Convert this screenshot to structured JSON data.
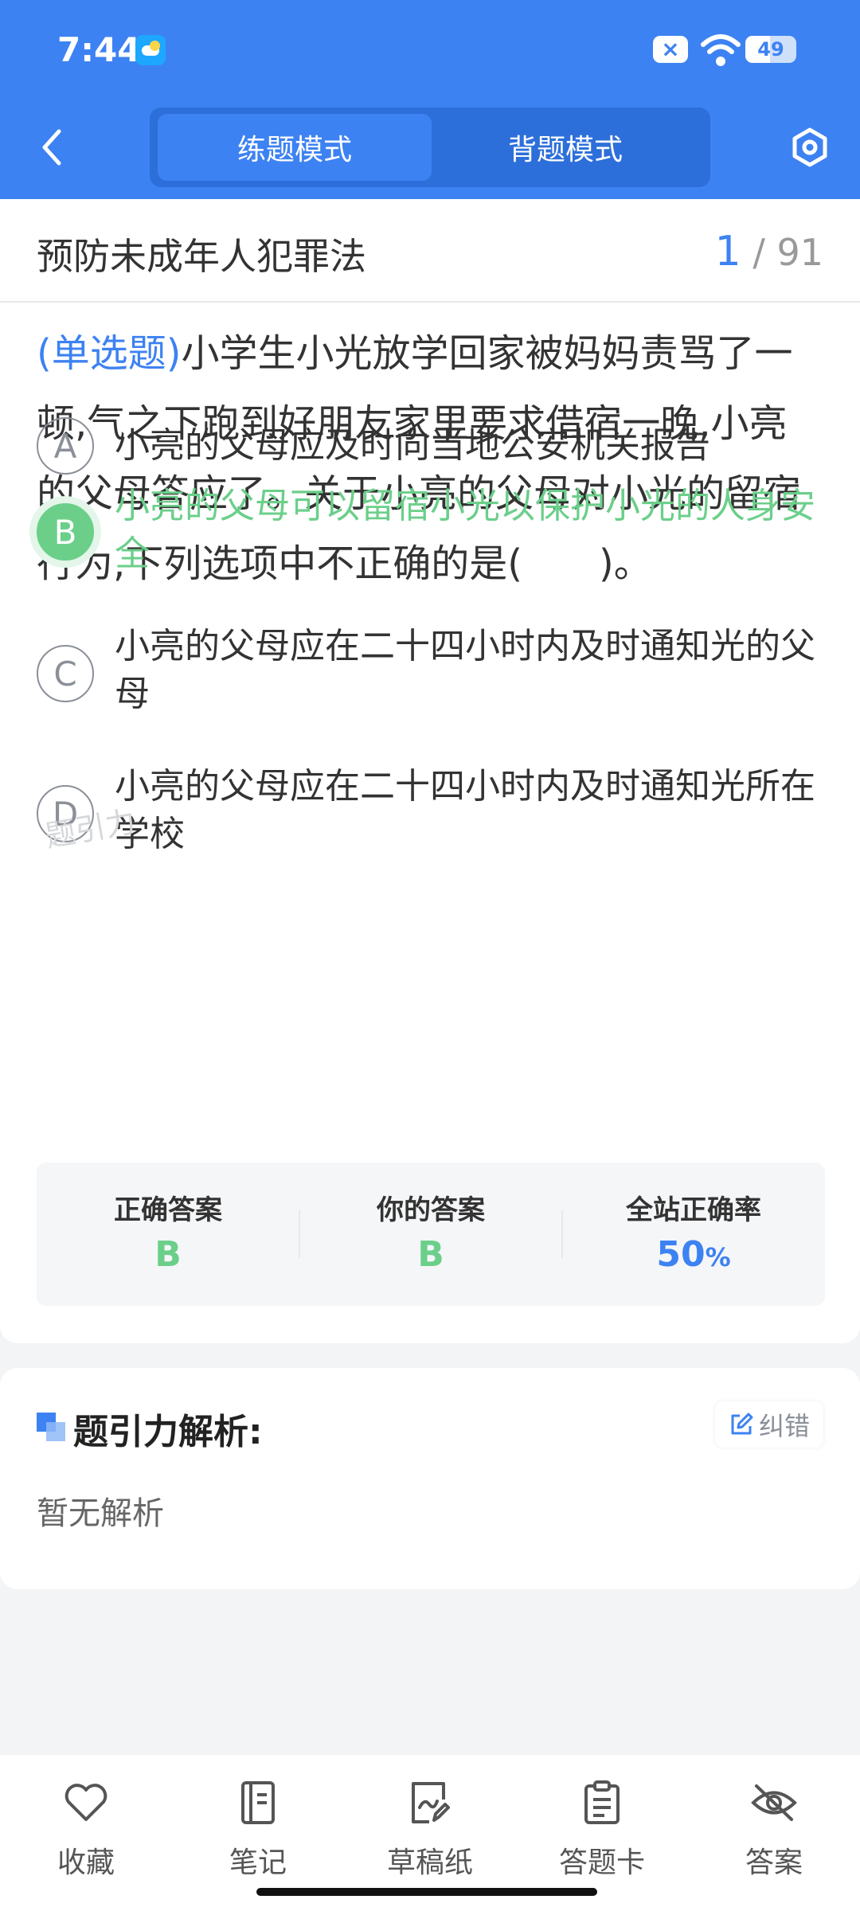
{
  "status_bar": {
    "time": "7:44",
    "battery": "49"
  },
  "nav": {
    "tabs": [
      {
        "label": "练题模式",
        "active": true
      },
      {
        "label": "背题模式",
        "active": false
      }
    ]
  },
  "exam": {
    "title": "预防未成年人犯罪法",
    "current": "1",
    "total": "91"
  },
  "question": {
    "type": "(单选题)",
    "text": "小学生小光放学回家被妈妈责骂了一顿,气之下跑到好朋友家里要求借宿一晚,小亮的父母答应了。关于小亮的父母对小光的留宿行为,下列选项中不正确的是(　　)。"
  },
  "options": [
    {
      "letter": "A",
      "text": "小亮的父母应及时向当地公安机关报告",
      "state": "normal"
    },
    {
      "letter": "B",
      "text": "小亮的父母可以留宿小光以保护小光的人身安全",
      "state": "correct"
    },
    {
      "letter": "C",
      "text": "小亮的父母应在二十四小时内及时通知光的父母",
      "state": "normal"
    },
    {
      "letter": "D",
      "text": "小亮的父母应在二十四小时内及时通知光所在学校",
      "state": "normal"
    }
  ],
  "watermark": "题引力",
  "stats": {
    "correct_label": "正确答案",
    "correct_value": "B",
    "yours_label": "你的答案",
    "yours_value": "B",
    "rate_label": "全站正确率",
    "rate_value": "50",
    "rate_unit": "%"
  },
  "analysis": {
    "title": "题引力解析:",
    "correction_label": "纠错",
    "content": "暂无解析"
  },
  "bottom_bar": [
    {
      "label": "收藏",
      "icon": "heart-icon"
    },
    {
      "label": "笔记",
      "icon": "notebook-icon"
    },
    {
      "label": "草稿纸",
      "icon": "draft-icon"
    },
    {
      "label": "答题卡",
      "icon": "answer-card-icon"
    },
    {
      "label": "答案",
      "icon": "eye-off-icon"
    }
  ],
  "colors": {
    "primary": "#3d82f2",
    "correct": "#6bcf8a"
  }
}
